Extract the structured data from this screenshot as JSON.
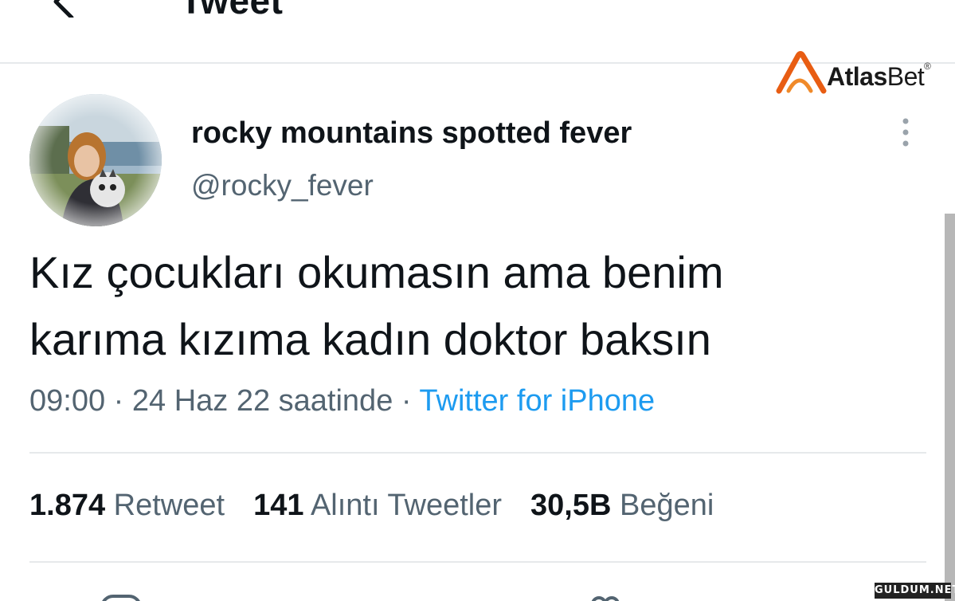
{
  "header": {
    "title": "Tweet",
    "back_icon": "arrow-left-icon"
  },
  "watermark": {
    "brand_bold": "Atlas",
    "brand_light": "Bet",
    "registered": "®",
    "logo_color": "#e85d13"
  },
  "author": {
    "display_name": "rocky mountains spotted fever",
    "handle": "@rocky_fever",
    "avatar_icon": "avatar-photo"
  },
  "tweet": {
    "line1": "Kız çocukları okumasın ama benim",
    "line2": "karıma kızıma kadın doktor baksın"
  },
  "meta": {
    "time": "09:00",
    "separator": "·",
    "date": "24 Haz 22 saatinde",
    "source": "Twitter for iPhone"
  },
  "stats": {
    "retweets_count": "1.874",
    "retweets_label": "Retweet",
    "quotes_count": "141",
    "quotes_label": "Alıntı Tweetler",
    "likes_count": "30,5B",
    "likes_label": "Beğeni"
  },
  "footer_watermark": "GULDUM.NET",
  "colors": {
    "link": "#1d9bf0",
    "secondary_text": "#536471",
    "primary_text": "#0f1419",
    "divider": "#e6e9eb"
  }
}
